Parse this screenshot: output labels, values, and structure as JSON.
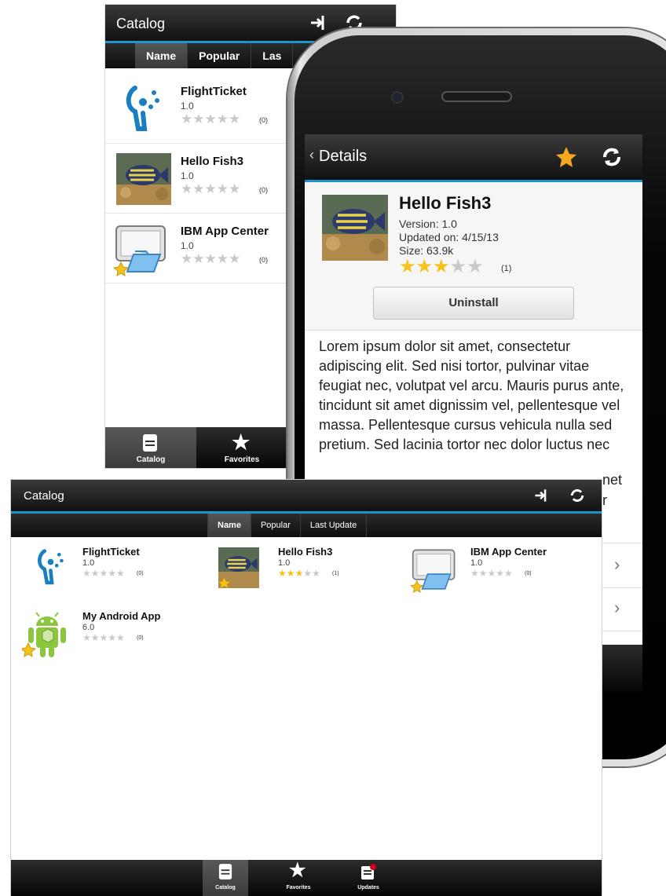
{
  "background_catalog": {
    "title": "Catalog",
    "tabs": [
      "Name",
      "Popular",
      "Las"
    ],
    "apps": [
      {
        "name": "FlightTicket",
        "version": "1.0",
        "rating": 0,
        "count": "(0)"
      },
      {
        "name": "Hello Fish3",
        "version": "1.0",
        "rating": 0,
        "count": "(0)"
      },
      {
        "name": "IBM App Center",
        "version": "1.0",
        "rating": 0,
        "count": "(0)"
      }
    ],
    "nav": {
      "catalog": "Catalog",
      "favorites": "Favorites"
    }
  },
  "details": {
    "back_label": "Details",
    "app_name": "Hello Fish3",
    "version": "Version: 1.0",
    "updated": "Updated on: 4/15/13",
    "size": "Size: 63.9k",
    "rating": 3,
    "rating_count": "(1)",
    "uninstall": "Uninstall",
    "description": "Lorem ipsum dolor sit amet, consectetur adipiscing elit. Sed nisi tortor, pulvinar vitae feugiat nec, volutpat vel arcu. Mauris purus ante, tincidunt sit amet dignissim vel, pellentesque vel massa. Pellentesque cursus vehicula nulla sed pretium. Sed lacinia tortor nec dolor luctus nec",
    "description_fragment_1": "net",
    "description_fragment_2": "r"
  },
  "tablet_catalog": {
    "title": "Catalog",
    "tabs": [
      "Name",
      "Popular",
      "Last Update"
    ],
    "apps": [
      {
        "name": "FlightTicket",
        "version": "1.0",
        "rating": 0,
        "count": "(0)"
      },
      {
        "name": "Hello Fish3",
        "version": "1.0",
        "rating": 3,
        "count": "(1)"
      },
      {
        "name": "IBM App Center",
        "version": "1.0",
        "rating": 0,
        "count": "(0)"
      },
      {
        "name": "My Android App",
        "version": "6.0",
        "rating": 0,
        "count": "(0)"
      }
    ],
    "nav": {
      "catalog": "Catalog",
      "favorites": "Favorites",
      "updates": "Updates"
    }
  },
  "colors": {
    "accent": "#1f93cc",
    "star_on": "#f4c21b",
    "star_off": "#c9c9c9",
    "bar_dark": "#111111"
  }
}
